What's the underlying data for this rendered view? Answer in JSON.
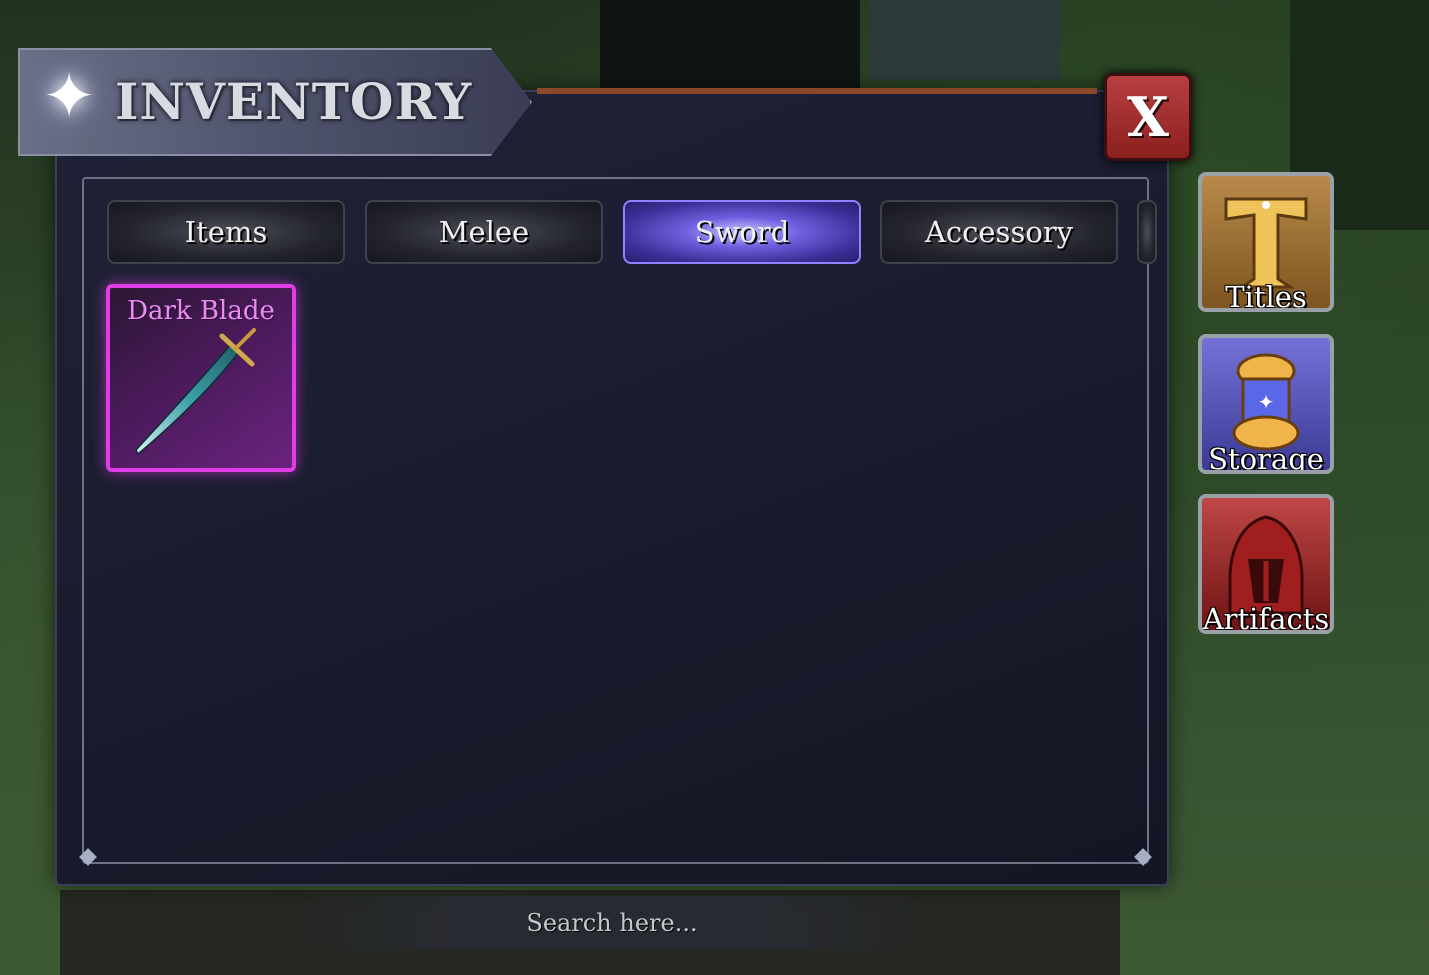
{
  "window": {
    "title": "INVENTORY",
    "close_label": "X"
  },
  "tabs": [
    {
      "label": "Items",
      "active": false
    },
    {
      "label": "Melee",
      "active": false
    },
    {
      "label": "Sword",
      "active": true
    },
    {
      "label": "Accessory",
      "active": false
    }
  ],
  "items": [
    {
      "name": "Dark Blade",
      "icon": "sword-icon",
      "rarity_color": "#e03de6"
    }
  ],
  "side_menu": [
    {
      "label": "Titles",
      "icon": "title-t-icon"
    },
    {
      "label": "Storage",
      "icon": "storage-capsule-icon"
    },
    {
      "label": "Artifacts",
      "icon": "hooded-knight-icon"
    }
  ],
  "search": {
    "placeholder": "Search here..."
  },
  "colors": {
    "active_tab": "#6f5fe0",
    "item_border": "#e03de6",
    "close_button": "#b84040"
  }
}
